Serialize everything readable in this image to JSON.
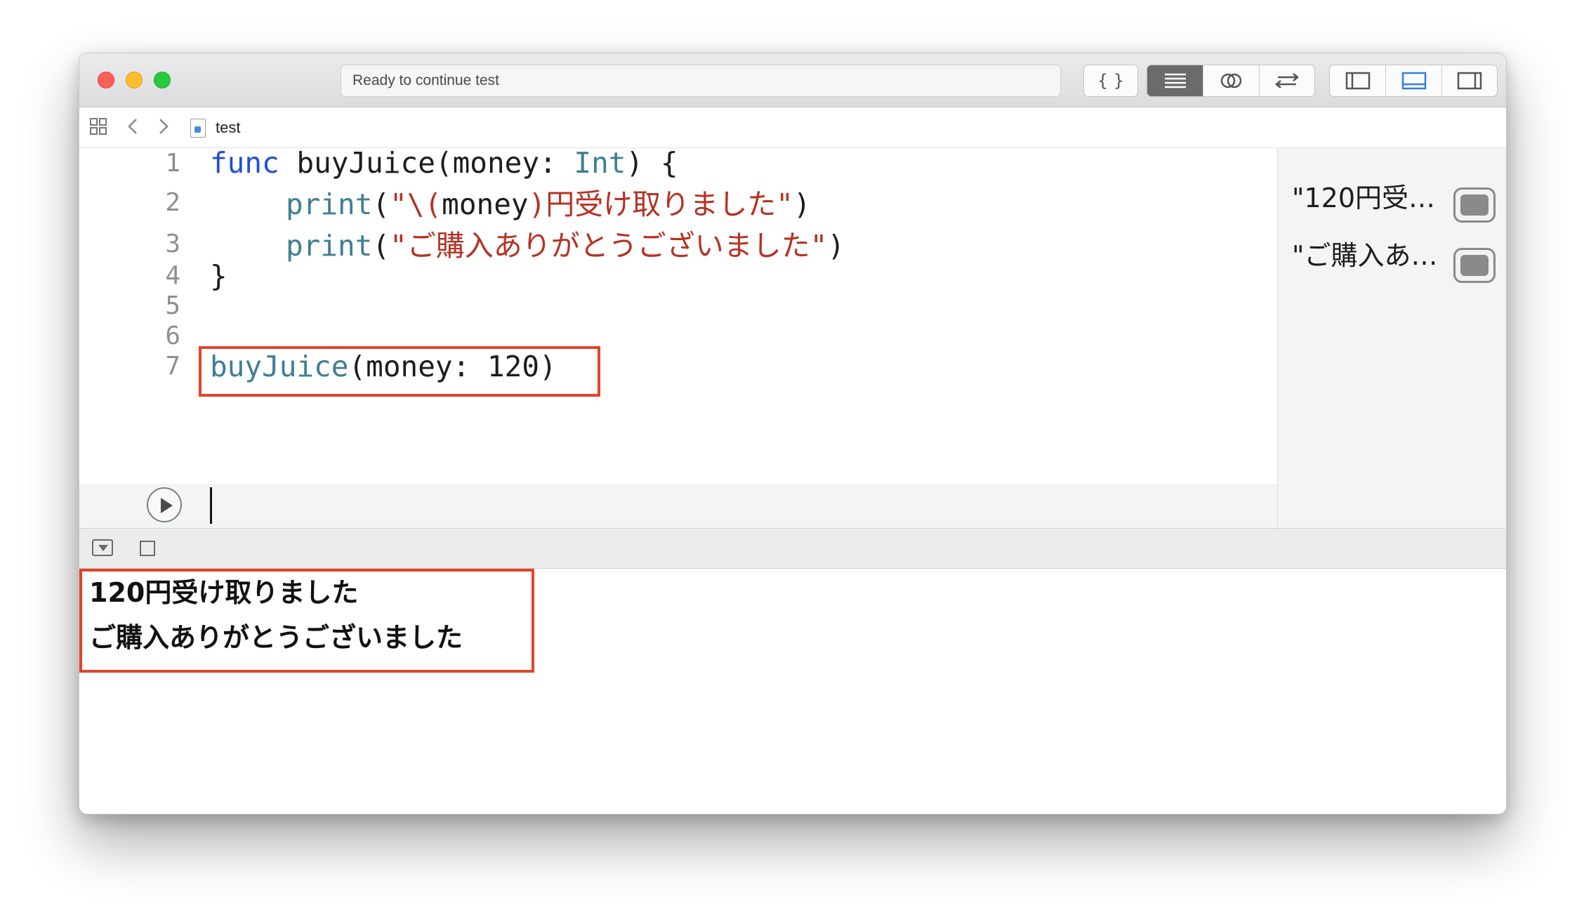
{
  "toolbar": {
    "status": "Ready to continue test",
    "editor_mode_icons": [
      "braces-icon"
    ],
    "view_mode_icons": [
      "standard-editor-icon",
      "assistant-editor-icon",
      "version-editor-icon"
    ],
    "panel_icons": [
      "navigator-toggle-icon",
      "debug-area-toggle-icon",
      "utilities-toggle-icon"
    ]
  },
  "jumpbar": {
    "file_name": "test"
  },
  "editor": {
    "line_numbers": [
      "1",
      "2",
      "3",
      "4",
      "5",
      "6",
      "7"
    ],
    "lines": {
      "l1_kw": "func",
      "l1_name": " buyJuice(money: ",
      "l1_type": "Int",
      "l1_end": ") {",
      "l2_fn": "print",
      "l2_open": "(",
      "l2_q1": "\"\\",
      "l2_p1": "(",
      "l2_arg": "money",
      "l2_p2": ")",
      "l2_str": "円受け取りました\"",
      "l2_close": ")",
      "l3_fn": "print",
      "l3_open": "(",
      "l3_str": "\"ご購入ありがとうございました\"",
      "l3_close": ")",
      "l4": "}",
      "l7_fn": "buyJuice",
      "l7_args": "(money: 120)"
    }
  },
  "results": [
    "\"120円受…",
    "\"ご購入あ…"
  ],
  "console": {
    "lines": [
      "120円受け取りました",
      "ご購入ありがとうございました"
    ]
  },
  "colors": {
    "keyword": "#1f4fd6",
    "type": "#3f7f93",
    "string": "#b53224",
    "highlight_box": "#e2442a"
  }
}
